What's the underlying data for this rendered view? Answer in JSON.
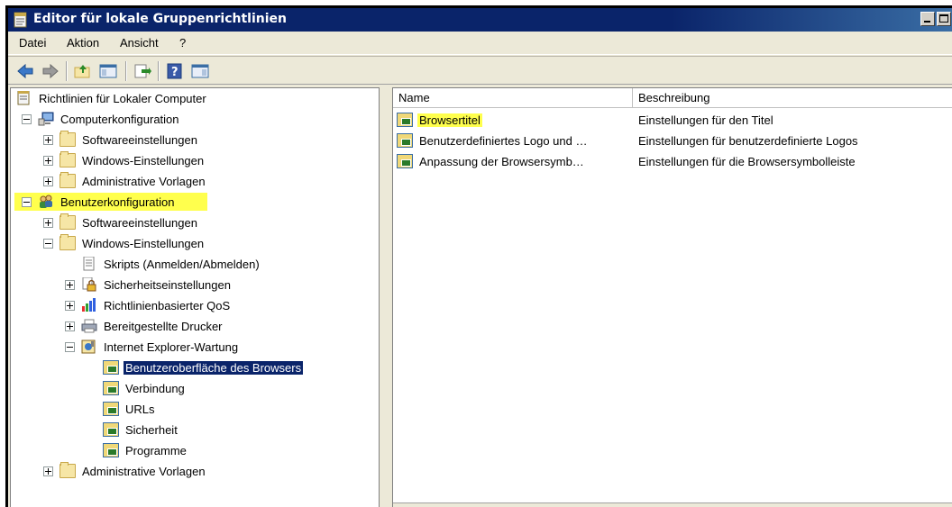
{
  "window": {
    "title": "Editor für lokale Gruppenrichtlinien"
  },
  "menu": [
    "Datei",
    "Aktion",
    "Ansicht",
    "?"
  ],
  "toolbar": {
    "buttons": [
      "back-icon",
      "forward-icon",
      "up-folder-icon",
      "show-hide-tree-icon",
      "export-list-icon",
      "help-icon",
      "show-action-pane-icon"
    ]
  },
  "tree": {
    "root": "Richtlinien für Lokaler Computer",
    "computer": "Computerkonfiguration",
    "c_software": "Softwareeinstellungen",
    "c_windows": "Windows-Einstellungen",
    "c_admin": "Administrative Vorlagen",
    "user": "Benutzerkonfiguration",
    "u_software": "Softwareeinstellungen",
    "u_windows": "Windows-Einstellungen",
    "scripts": "Skripts (Anmelden/Abmelden)",
    "security_settings": "Sicherheitseinstellungen",
    "qos": "Richtlinienbasierter QoS",
    "printers": "Bereitgestellte Drucker",
    "ie": "Internet Explorer-Wartung",
    "ie_ui": "Benutzeroberfläche des Browsers",
    "ie_conn": "Verbindung",
    "ie_urls": "URLs",
    "ie_sec": "Sicherheit",
    "ie_prog": "Programme",
    "u_admin": "Administrative Vorlagen"
  },
  "list": {
    "columns": [
      "Name",
      "Beschreibung"
    ],
    "rows": [
      {
        "name": "Browsertitel",
        "desc": "Einstellungen für den Titel"
      },
      {
        "name": "Benutzerdefiniertes Logo und …",
        "desc": "Einstellungen für benutzerdefinierte Logos"
      },
      {
        "name": "Anpassung der Browsersymb…",
        "desc": "Einstellungen für die Browsersymbolleiste"
      }
    ]
  },
  "colors": {
    "highlight": "#ffff4d",
    "selection": "#0a246a",
    "titlebar": "#0a246a"
  }
}
